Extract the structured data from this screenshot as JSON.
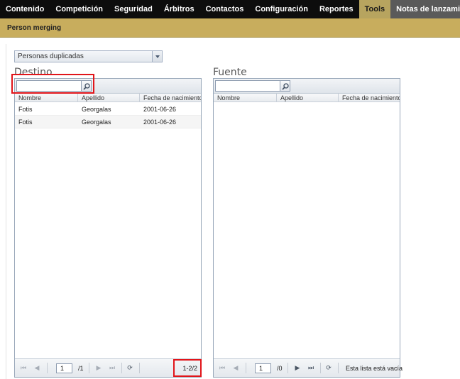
{
  "nav": {
    "items": [
      {
        "label": "Contenido"
      },
      {
        "label": "Competición"
      },
      {
        "label": "Seguridad"
      },
      {
        "label": "Árbitros"
      },
      {
        "label": "Contactos"
      },
      {
        "label": "Configuración"
      },
      {
        "label": "Reportes"
      },
      {
        "label": "Tools"
      },
      {
        "label": "Notas de lanzamiento"
      }
    ],
    "active": "Tools"
  },
  "page": {
    "subtitle": "Person merging"
  },
  "filter": {
    "selected": "Personas duplicadas"
  },
  "target": {
    "title": "Destino",
    "search_value": "",
    "columns": [
      "Nombre",
      "Apellido",
      "Fecha de nacimiento"
    ],
    "rows": [
      {
        "nombre": "Fotis",
        "apellido": "Georgalas",
        "fecha": "2001-06-26"
      },
      {
        "nombre": "Fotis",
        "apellido": "Georgalas",
        "fecha": "2001-06-26"
      }
    ],
    "pager": {
      "page": "1",
      "total": "/1",
      "info": "1-2/2"
    }
  },
  "source": {
    "title": "Fuente",
    "search_value": "",
    "columns": [
      "Nombre",
      "Apellido",
      "Fecha de nacimiento"
    ],
    "rows": [],
    "pager": {
      "page": "1",
      "total": "/0",
      "info": "Esta lista está vacía"
    }
  },
  "colors": {
    "nav_bg": "#0d0d0d",
    "nav_active": "#b7a45f",
    "nav_notes": "#5a5a5a",
    "subbar": "#c8ad5d",
    "highlight": "#e1151a"
  }
}
